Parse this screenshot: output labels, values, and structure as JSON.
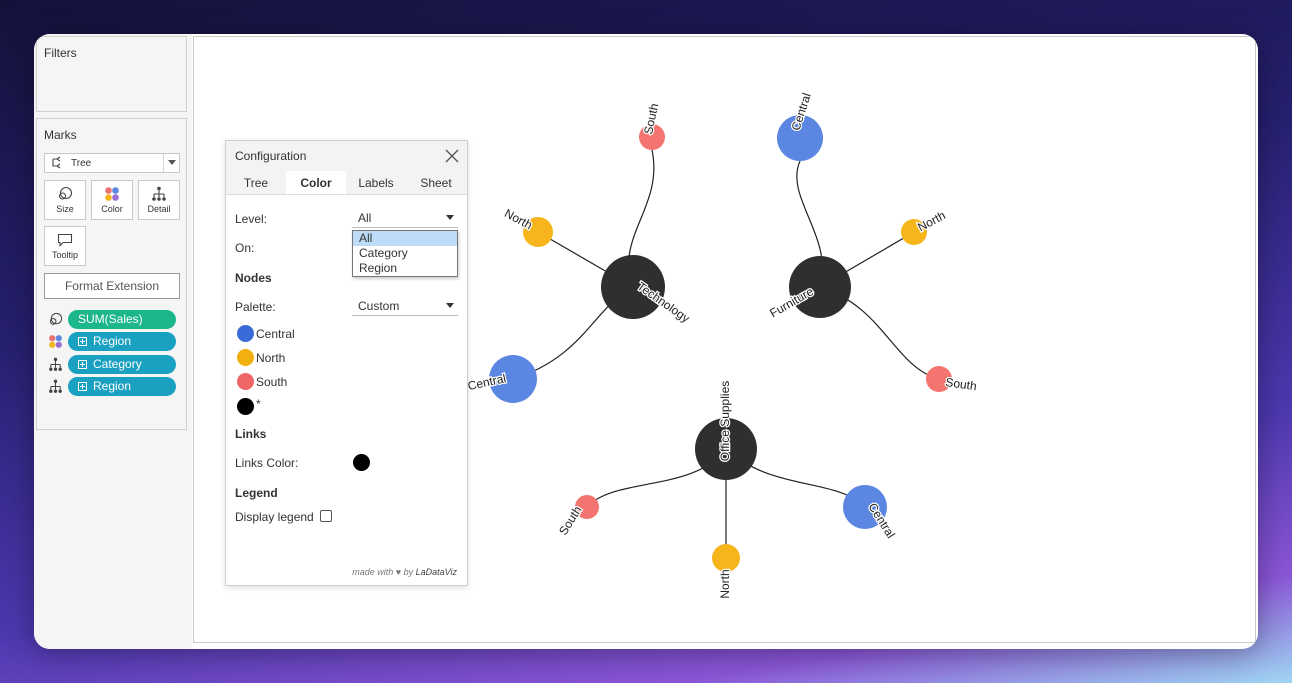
{
  "sidebar": {
    "filters_title": "Filters",
    "marks_title": "Marks",
    "mark_type": "Tree",
    "buttons": [
      {
        "label": "Size"
      },
      {
        "label": "Color"
      },
      {
        "label": "Detail"
      },
      {
        "label": "Tooltip"
      }
    ],
    "format_extension": "Format Extension",
    "pills": [
      {
        "icon": "size-icon",
        "label": "SUM(Sales)",
        "color": "#1bb68a",
        "has_plus": false
      },
      {
        "icon": "color-icon",
        "label": "Region",
        "color": "#1aa0c0",
        "has_plus": true
      },
      {
        "icon": "detail-icon",
        "label": "Category",
        "color": "#1aa0c0",
        "has_plus": true
      },
      {
        "icon": "detail-icon",
        "label": "Region",
        "color": "#1aa0c0",
        "has_plus": true
      }
    ]
  },
  "config": {
    "title": "Configuration",
    "tabs": [
      {
        "label": "Tree",
        "active": false
      },
      {
        "label": "Color",
        "active": true
      },
      {
        "label": "Labels",
        "active": false
      },
      {
        "label": "Sheet",
        "active": false
      }
    ],
    "level_label": "Level:",
    "level_value": "All",
    "level_options": [
      "All",
      "Category",
      "Region"
    ],
    "on_label": "On:",
    "nodes_heading": "Nodes",
    "palette_label": "Palette:",
    "palette_value": "Custom",
    "swatches": [
      {
        "label": "Central",
        "color": "#3a6bd8"
      },
      {
        "label": "North",
        "color": "#f2b010"
      },
      {
        "label": "South",
        "color": "#f06565"
      },
      {
        "label": "*",
        "color": "#000000"
      }
    ],
    "links_heading": "Links",
    "links_color_label": "Links Color:",
    "links_color": "#000000",
    "legend_heading": "Legend",
    "display_legend_label": "Display legend",
    "display_legend_checked": false,
    "credit_prefix": "made with ♥ by ",
    "credit_brand": "LaDataViz"
  },
  "tree": {
    "colors": {
      "Central": "#5b86e2",
      "North": "#f5b51b",
      "South": "#f47470",
      "root": "#2f2f2f"
    },
    "groups": [
      {
        "label": "Technology",
        "children": [
          "South",
          "North",
          "Central"
        ]
      },
      {
        "label": "Furniture",
        "children": [
          "Central",
          "North",
          "South"
        ]
      },
      {
        "label": "Office Supplies",
        "children": [
          "South",
          "North",
          "Central"
        ]
      }
    ]
  }
}
